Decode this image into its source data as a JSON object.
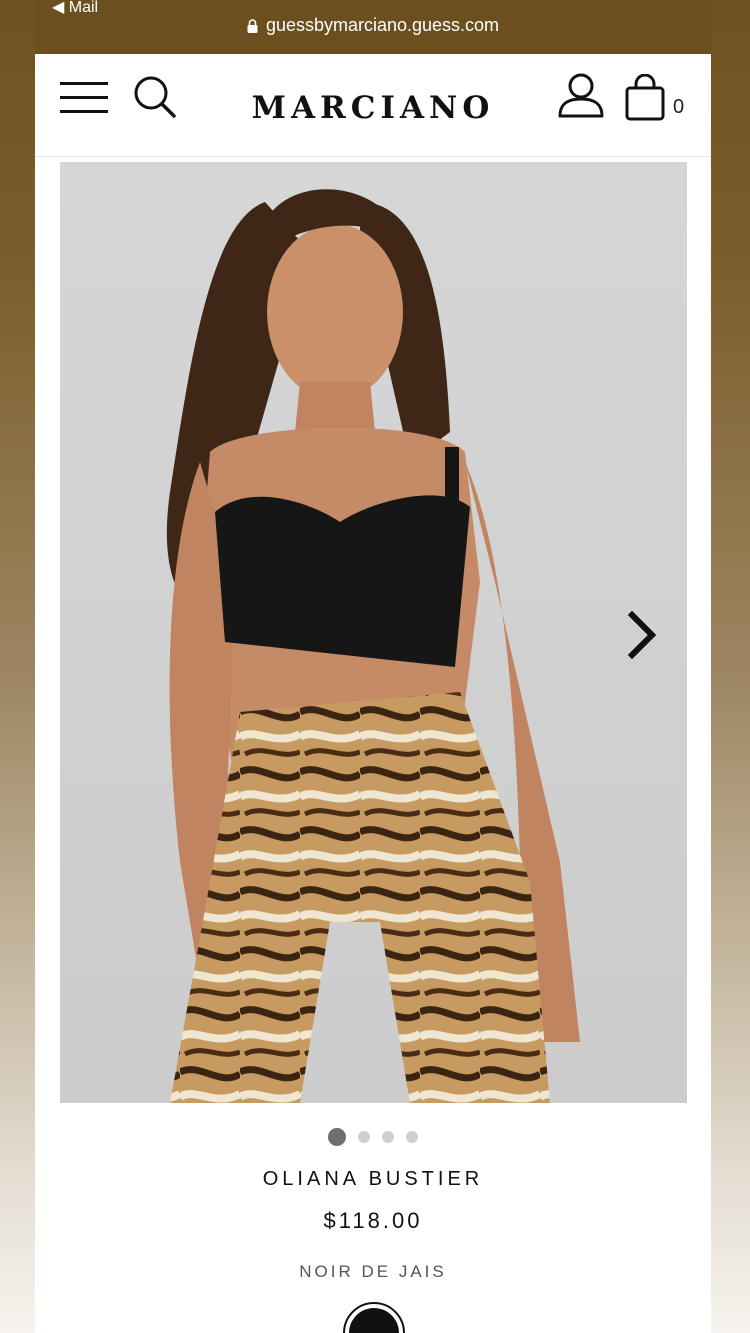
{
  "status_bar": {
    "back_label": "◀ Mail",
    "url": "guessbymarciano.guess.com"
  },
  "header": {
    "logo": "MARCIANO",
    "cart_count": "0"
  },
  "product": {
    "image_alt_icon": "product-photo",
    "carousel_dots": 4,
    "carousel_active": 1,
    "name": "OLIANA BUSTIER",
    "price": "$118.00",
    "color_name": "NOIR DE JAIS",
    "swatch_color": "#111111"
  },
  "colors": {
    "status_bar_bg": "#6b4f1e",
    "page_bg": "#ffffff",
    "image_bg": "#d4d4d4"
  }
}
